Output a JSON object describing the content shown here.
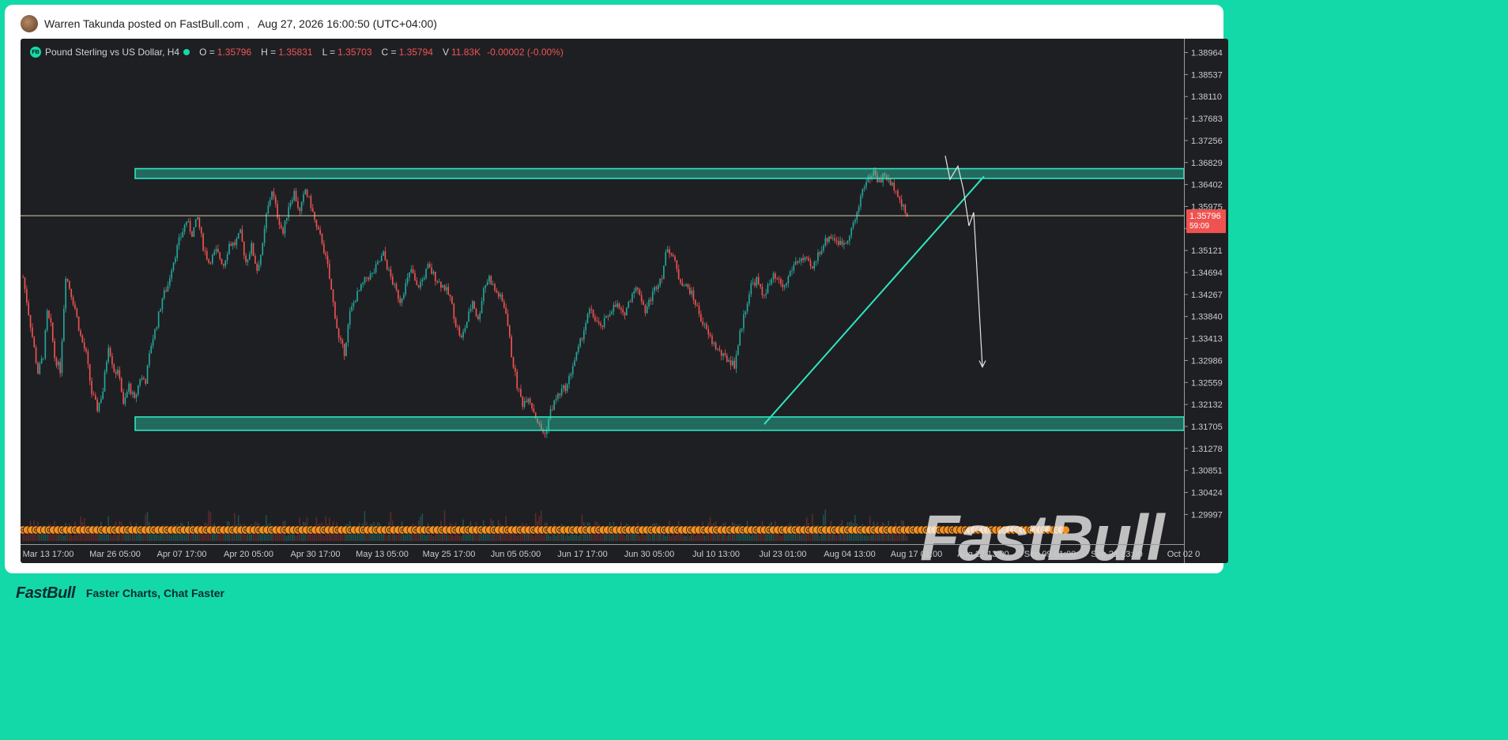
{
  "post": {
    "author_line": "Warren Takunda posted on FastBull.com",
    "separator": ",",
    "timestamp": "Aug 27, 2026 16:00:50 (UTC+04:00)"
  },
  "legend": {
    "badge": "FB",
    "symbol": "Pound Sterling vs US Dollar, H4",
    "o_label": "O =",
    "o_value": "1.35796",
    "h_label": "H =",
    "h_value": "1.35831",
    "l_label": "L =",
    "l_value": "1.35703",
    "c_label": "C =",
    "c_value": "1.35794",
    "v_label": "V",
    "v_value": "11.83K",
    "change": "-0.00002 (-0.00%)"
  },
  "price_tag": {
    "price": "1.35796",
    "countdown": "59:09"
  },
  "watermark": "FastBull",
  "footer": {
    "logo": "FastBull",
    "tagline": "Faster Charts, Chat Faster"
  },
  "colors": {
    "up": "#26a69a",
    "down": "#ef5350",
    "zone": "#2ee6c0",
    "accent": "#13d9a9",
    "price_tag": "#ef5350",
    "event_marker": "#f5901e"
  },
  "chart_data": {
    "type": "candlestick",
    "instrument": "Pound Sterling vs US Dollar",
    "timeframe": "H4",
    "y_ticks": [
      "1.38964",
      "1.38537",
      "1.38110",
      "1.37683",
      "1.37256",
      "1.36829",
      "1.36402",
      "1.35975",
      "1.35548",
      "1.35121",
      "1.34694",
      "1.34267",
      "1.33840",
      "1.33413",
      "1.32986",
      "1.32559",
      "1.32132",
      "1.31705",
      "1.31278",
      "1.30851",
      "1.30424",
      "1.29997"
    ],
    "ylim": [
      1.2985,
      1.3911
    ],
    "x_ticks": [
      "Mar 13 17:00",
      "Mar 26 05:00",
      "Apr 07 17:00",
      "Apr 20 05:00",
      "Apr 30 17:00",
      "May 13 05:00",
      "May 25 17:00",
      "Jun 05 05:00",
      "Jun 17 17:00",
      "Jun 30 05:00",
      "Jul 10 13:00",
      "Jul 23 01:00",
      "Aug 04 13:00",
      "Aug 17 01:00",
      "Aug 27 13:00",
      "Sep 09 01:00",
      "Sep 21 13:00",
      "Oct 02 0"
    ],
    "current_price": 1.35796,
    "price_path": [
      [
        0,
        1.346
      ],
      [
        5,
        1.3345
      ],
      [
        8,
        1.3275
      ],
      [
        11,
        1.331
      ],
      [
        13,
        1.339
      ],
      [
        15,
        1.3365
      ],
      [
        17,
        1.3305
      ],
      [
        20,
        1.328
      ],
      [
        23,
        1.3465
      ],
      [
        25,
        1.344
      ],
      [
        28,
        1.34
      ],
      [
        31,
        1.3345
      ],
      [
        34,
        1.331
      ],
      [
        37,
        1.3235
      ],
      [
        40,
        1.3205
      ],
      [
        43,
        1.324
      ],
      [
        46,
        1.333
      ],
      [
        49,
        1.328
      ],
      [
        52,
        1.327
      ],
      [
        54,
        1.321
      ],
      [
        57,
        1.325
      ],
      [
        60,
        1.322
      ],
      [
        63,
        1.3265
      ],
      [
        66,
        1.326
      ],
      [
        69,
        1.333
      ],
      [
        72,
        1.337
      ],
      [
        75,
        1.342
      ],
      [
        78,
        1.3445
      ],
      [
        80,
        1.348
      ],
      [
        84,
        1.353
      ],
      [
        88,
        1.357
      ],
      [
        91,
        1.3545
      ],
      [
        94,
        1.3575
      ],
      [
        97,
        1.352
      ],
      [
        100,
        1.349
      ],
      [
        104,
        1.351
      ],
      [
        108,
        1.3485
      ],
      [
        111,
        1.3525
      ],
      [
        114,
        1.3525
      ],
      [
        117,
        1.3545
      ],
      [
        120,
        1.349
      ],
      [
        123,
        1.352
      ],
      [
        126,
        1.3475
      ],
      [
        129,
        1.352
      ],
      [
        131,
        1.358
      ],
      [
        134,
        1.363
      ],
      [
        137,
        1.358
      ],
      [
        140,
        1.3545
      ],
      [
        143,
        1.36
      ],
      [
        146,
        1.3625
      ],
      [
        149,
        1.3585
      ],
      [
        152,
        1.363
      ],
      [
        155,
        1.36
      ],
      [
        158,
        1.3555
      ],
      [
        161,
        1.353
      ],
      [
        164,
        1.348
      ],
      [
        167,
        1.341
      ],
      [
        170,
        1.334
      ],
      [
        173,
        1.3315
      ],
      [
        176,
        1.339
      ],
      [
        179,
        1.342
      ],
      [
        182,
        1.344
      ],
      [
        185,
        1.346
      ],
      [
        188,
        1.3465
      ],
      [
        191,
        1.3485
      ],
      [
        194,
        1.3505
      ],
      [
        197,
        1.347
      ],
      [
        200,
        1.344
      ],
      [
        203,
        1.3415
      ],
      [
        206,
        1.3445
      ],
      [
        209,
        1.3475
      ],
      [
        212,
        1.344
      ],
      [
        215,
        1.3455
      ],
      [
        218,
        1.348
      ],
      [
        221,
        1.3465
      ],
      [
        224,
        1.345
      ],
      [
        227,
        1.344
      ],
      [
        230,
        1.342
      ],
      [
        233,
        1.337
      ],
      [
        236,
        1.334
      ],
      [
        239,
        1.3375
      ],
      [
        242,
        1.3415
      ],
      [
        245,
        1.3375
      ],
      [
        248,
        1.344
      ],
      [
        251,
        1.346
      ],
      [
        254,
        1.3435
      ],
      [
        257,
        1.342
      ],
      [
        260,
        1.3395
      ],
      [
        263,
        1.331
      ],
      [
        266,
        1.325
      ],
      [
        269,
        1.3215
      ],
      [
        272,
        1.323
      ],
      [
        275,
        1.32
      ],
      [
        278,
        1.317
      ],
      [
        281,
        1.3155
      ],
      [
        284,
        1.32
      ],
      [
        287,
        1.3225
      ],
      [
        290,
        1.324
      ],
      [
        293,
        1.325
      ],
      [
        296,
        1.329
      ],
      [
        299,
        1.332
      ],
      [
        302,
        1.336
      ],
      [
        305,
        1.3395
      ],
      [
        308,
        1.338
      ],
      [
        311,
        1.336
      ],
      [
        314,
        1.338
      ],
      [
        317,
        1.34
      ],
      [
        320,
        1.3405
      ],
      [
        323,
        1.3385
      ],
      [
        326,
        1.341
      ],
      [
        329,
        1.344
      ],
      [
        332,
        1.343
      ],
      [
        335,
        1.3395
      ],
      [
        338,
        1.342
      ],
      [
        341,
        1.3445
      ],
      [
        344,
        1.3465
      ],
      [
        347,
        1.352
      ],
      [
        350,
        1.35
      ],
      [
        353,
        1.346
      ],
      [
        356,
        1.3445
      ],
      [
        359,
        1.3435
      ],
      [
        362,
        1.341
      ],
      [
        365,
        1.338
      ],
      [
        368,
        1.3355
      ],
      [
        371,
        1.3335
      ],
      [
        374,
        1.332
      ],
      [
        377,
        1.3305
      ],
      [
        380,
        1.33
      ],
      [
        383,
        1.329
      ],
      [
        386,
        1.335
      ],
      [
        389,
        1.34
      ],
      [
        392,
        1.3445
      ],
      [
        395,
        1.3455
      ],
      [
        398,
        1.3425
      ],
      [
        401,
        1.344
      ],
      [
        404,
        1.346
      ],
      [
        407,
        1.345
      ],
      [
        410,
        1.344
      ],
      [
        413,
        1.347
      ],
      [
        416,
        1.349
      ],
      [
        419,
        1.3495
      ],
      [
        422,
        1.349
      ],
      [
        425,
        1.3475
      ],
      [
        428,
        1.3505
      ],
      [
        431,
        1.3525
      ],
      [
        434,
        1.354
      ],
      [
        437,
        1.3535
      ],
      [
        440,
        1.3525
      ],
      [
        443,
        1.353
      ],
      [
        446,
        1.3555
      ],
      [
        449,
        1.358
      ],
      [
        452,
        1.3635
      ],
      [
        455,
        1.365
      ],
      [
        458,
        1.3665
      ],
      [
        461,
        1.3645
      ],
      [
        464,
        1.366
      ],
      [
        467,
        1.364
      ],
      [
        470,
        1.3635
      ],
      [
        473,
        1.36
      ],
      [
        476,
        1.358
      ]
    ],
    "zones": [
      {
        "start": 1,
        "from": 1.3652,
        "to": 1.3671
      },
      {
        "start": 1,
        "from": 1.3163,
        "to": 1.3189
      }
    ],
    "trendline": {
      "from": [
        1,
        1.3175
      ],
      "to": [
        1,
        1.3656
      ]
    },
    "horizontal_line": 1.35796,
    "projection": [
      [
        1.3696
      ],
      [
        1.365
      ],
      [
        1.3676
      ],
      [
        1.363
      ],
      [
        1.356
      ],
      [
        1.3586
      ],
      [
        1.3286
      ]
    ],
    "grid": false,
    "volume": true
  }
}
